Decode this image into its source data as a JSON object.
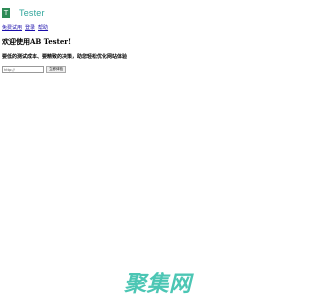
{
  "header": {
    "logo_glyph": "T",
    "brand_name": "Tester"
  },
  "nav": {
    "items": [
      {
        "label": "免费试用"
      },
      {
        "label": "登录"
      },
      {
        "label": "帮助"
      }
    ]
  },
  "main": {
    "title": "欢迎使用AB Tester!",
    "subtitle": "要低的测试成本、要精致的决策，助您轻松优化网站体验",
    "url_input": {
      "value": "http://"
    },
    "submit_label": "立即体验"
  },
  "watermark": {
    "text": "聚集网"
  },
  "colors": {
    "brand_green": "#2e8b57",
    "brand_text": "#2fa59a",
    "watermark": "#43c3b0",
    "link": "#1a0dab"
  }
}
